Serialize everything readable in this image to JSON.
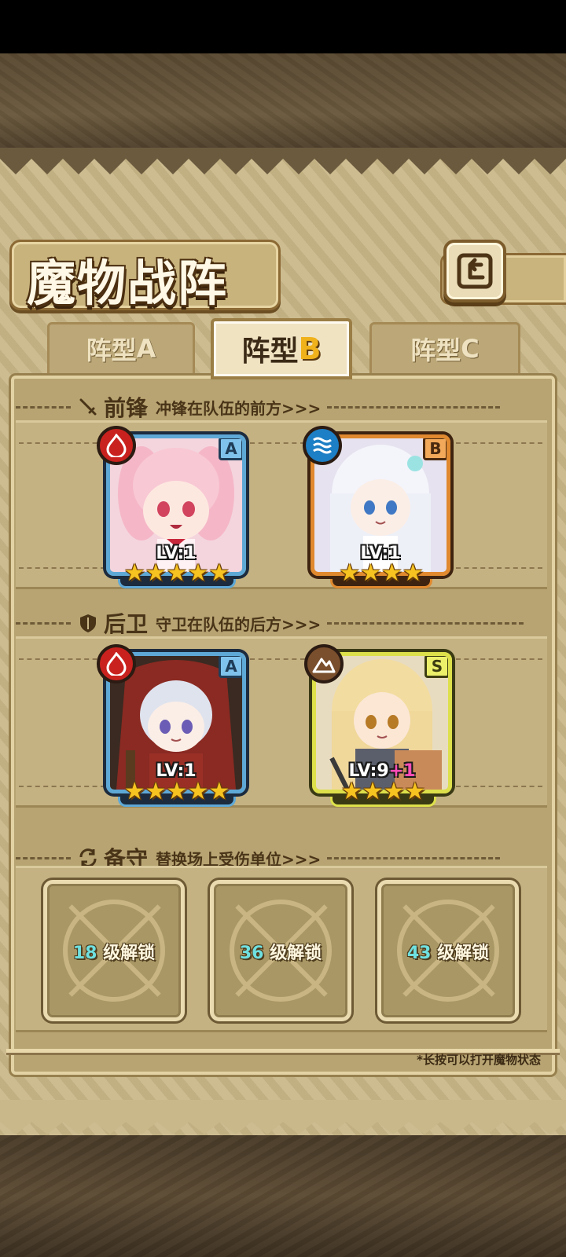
{
  "title": "魔物战阵",
  "tabs": [
    {
      "label": "阵型",
      "letter": "A",
      "active": false
    },
    {
      "label": "阵型",
      "letter": "B",
      "active": true
    },
    {
      "label": "阵型",
      "letter": "C",
      "active": false
    }
  ],
  "sections": {
    "front": {
      "title": "前锋",
      "subtitle": "冲锋在队伍的前方>>>",
      "icon": "sword-icon"
    },
    "back": {
      "title": "后卫",
      "subtitle": "守卫在队伍的后方>>>",
      "icon": "shield-icon"
    },
    "reserve": {
      "title": "备守",
      "subtitle": "替换场上受伤单位>>>",
      "icon": "swap-icon"
    }
  },
  "front_units": [
    {
      "name": "pink-mage",
      "rank": "A",
      "element": "fire-icon",
      "level": "LV:1",
      "stars": 5,
      "plus": ""
    },
    {
      "name": "white-elf",
      "rank": "B",
      "element": "water-icon",
      "level": "LV:1",
      "stars": 4,
      "plus": ""
    }
  ],
  "back_units": [
    {
      "name": "red-hood",
      "rank": "A",
      "element": "fire-icon",
      "level": "LV:1",
      "stars": 5,
      "plus": ""
    },
    {
      "name": "blonde-knight",
      "rank": "S",
      "element": "earth-icon",
      "level": "LV:9",
      "stars": 4,
      "plus": "+1"
    }
  ],
  "reserve_slots": [
    {
      "level": "18",
      "label": "级解锁"
    },
    {
      "level": "36",
      "label": "级解锁"
    },
    {
      "level": "43",
      "label": "级解锁"
    }
  ],
  "hint": "*长按可以打开魔物状态",
  "colors": {
    "accent_gold": "#f0b21b",
    "rank_a": "#5ea8d6",
    "rank_b": "#e0892f",
    "rank_s": "#dde04a",
    "unlock_num": "#6fe0e0"
  }
}
